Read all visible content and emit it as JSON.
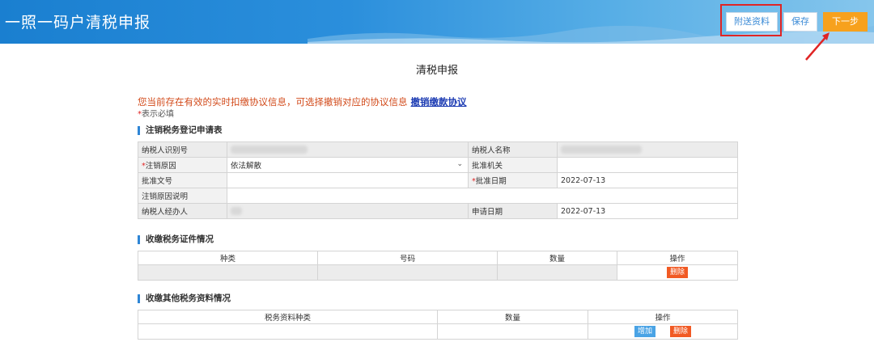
{
  "header": {
    "title": "一照一码户清税申报",
    "buttons": {
      "attach": "附送资料",
      "save": "保存",
      "next": "下一步"
    }
  },
  "page": {
    "title": "清税申报",
    "notice": "您当前存在有效的实时扣缴协议信息，可选择撤销对应的协议信息",
    "revoke_link": "撤销缴款协议",
    "required_star": "*",
    "required_text": "表示必填"
  },
  "reg_section": {
    "title": "注销税务登记申请表",
    "labels": {
      "taxpayer_id": "纳税人识别号",
      "taxpayer_name": "纳税人名称",
      "cancel_reason": "注销原因",
      "approval_org": "批准机关",
      "approval_doc": "批准文号",
      "approval_date": "批准日期",
      "reason_desc": "注销原因说明",
      "handler": "纳税人经办人",
      "apply_date": "申请日期"
    },
    "values": {
      "cancel_reason": "依法解散",
      "approval_date": "2022-07-13",
      "apply_date": "2022-07-13"
    }
  },
  "cert_section": {
    "title": "收缴税务证件情况",
    "columns": [
      "种类",
      "号码",
      "数量",
      "操作"
    ],
    "delete_label": "删除"
  },
  "other_section": {
    "title": "收缴其他税务资料情况",
    "columns": [
      "税务资料种类",
      "数量",
      "操作"
    ],
    "add_label": "增加",
    "delete_label": "删除"
  },
  "colors": {
    "header_blue": "#1a7fd0",
    "next_orange": "#f7a11d",
    "delete_red": "#f15a24",
    "add_blue": "#4aa3e5",
    "highlight_red": "#e02424"
  }
}
